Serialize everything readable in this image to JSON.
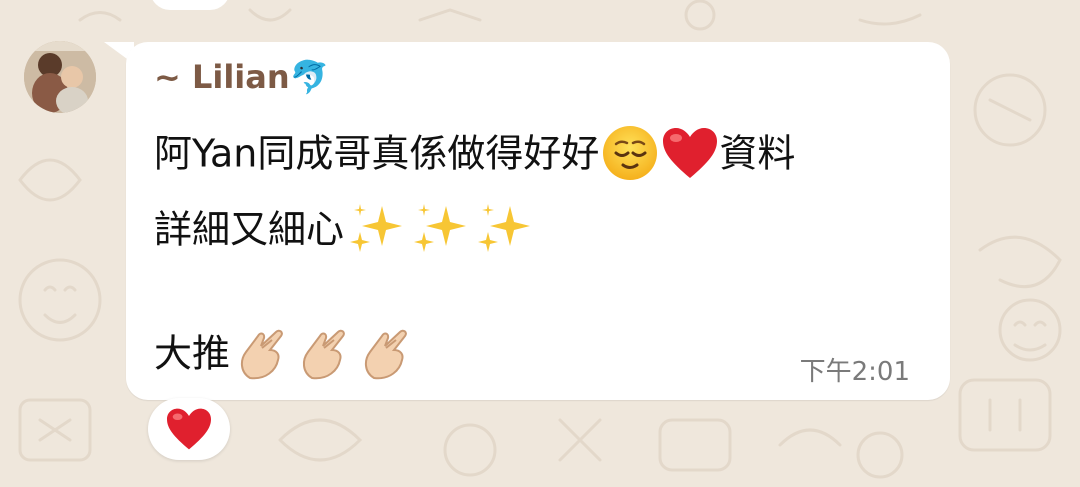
{
  "chat": {
    "sender_name": "~ Lilian",
    "sender_emoji": "🐬",
    "message": {
      "line1_text": "阿Yan同成哥真係做得好好",
      "line1_tail": "資料",
      "line2_text": "詳細又細心",
      "line3_text": "大推",
      "emoji_face": "relieved-face",
      "emoji_heart": "red-heart",
      "emoji_sparkles": "sparkles",
      "emoji_hand": "hand-with-index-finger-and-thumb-crossed"
    },
    "timestamp": "下午2:01",
    "reaction": "❤️"
  },
  "colors": {
    "wallpaper": "#efe7dc",
    "bubble": "#ffffff",
    "sender_name": "#7d5a45",
    "message_text": "#111111",
    "timestamp": "#7a7a7a",
    "heart": "#e0202e"
  }
}
